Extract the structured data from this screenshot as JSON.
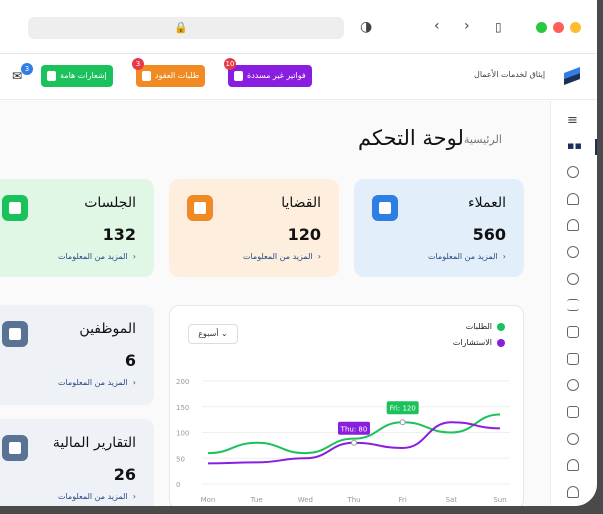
{
  "browser": {
    "dots": [
      "#28c840",
      "#ff5f57",
      "#febc2e"
    ]
  },
  "header": {
    "brand": "إيثاق لخدمات الأعمال",
    "buttons": [
      {
        "label": "فواتير غير مسددة",
        "badge": "10",
        "color": "#8a1ee0"
      },
      {
        "label": "طلبات العقود",
        "badge": "3",
        "color": "#f08a22"
      },
      {
        "label": "إشعارات هامة",
        "badge": "",
        "color": "#1bc15a"
      }
    ],
    "mail_badge": "3"
  },
  "page": {
    "breadcrumb": "الرئيسية",
    "title": "لوحة التحكم"
  },
  "cards": {
    "clients": {
      "title": "العملاء",
      "value": "560",
      "more": "المزيد من المعلومات",
      "color": "#e2effb",
      "icon_color": "#2f7ee6"
    },
    "cases": {
      "title": "القضايا",
      "value": "120",
      "more": "المزيد من المعلومات",
      "color": "#fdeedd",
      "icon_color": "#f08a22"
    },
    "sessions": {
      "title": "الجلسات",
      "value": "132",
      "more": "المزيد من المعلومات",
      "color": "#e0f7e6",
      "icon_color": "#1bc15a"
    },
    "employees": {
      "title": "الموظفين",
      "value": "6",
      "more": "المزيد من المعلومات",
      "color": "#eef1f5",
      "icon_color": "#5a7293"
    },
    "finance": {
      "title": "التقارير المالية",
      "value": "26",
      "more": "المزيد من المعلومات",
      "color": "#eef1f5",
      "icon_color": "#5a7293"
    }
  },
  "chart": {
    "week_select": "أسبوع",
    "legend": [
      {
        "name": "الطلبات",
        "color": "#1bc15a"
      },
      {
        "name": "الاستشارات",
        "color": "#8a1ee0"
      }
    ]
  },
  "chart_data": {
    "type": "line",
    "x": [
      "Mon",
      "Tue",
      "Wed",
      "Thu",
      "Fri",
      "Sat",
      "Sun"
    ],
    "ylim": [
      0,
      200
    ],
    "yticks": [
      "0",
      "50",
      "100",
      "150",
      "200"
    ],
    "series": [
      {
        "name": "الطلبات",
        "values": [
          60,
          80,
          60,
          88,
          120,
          100,
          135
        ],
        "color": "#1bc15a"
      },
      {
        "name": "الاستشارات",
        "values": [
          40,
          42,
          50,
          80,
          70,
          120,
          108
        ],
        "color": "#8a1ee0"
      }
    ],
    "annotations": [
      {
        "label": "Thu: 80",
        "x": "Thu",
        "y": 80,
        "color": "#8a1ee0"
      },
      {
        "label": "Fri: 120",
        "x": "Fri",
        "y": 120,
        "color": "#1bc15a"
      }
    ],
    "grid": true,
    "legend_position": "top-right"
  }
}
